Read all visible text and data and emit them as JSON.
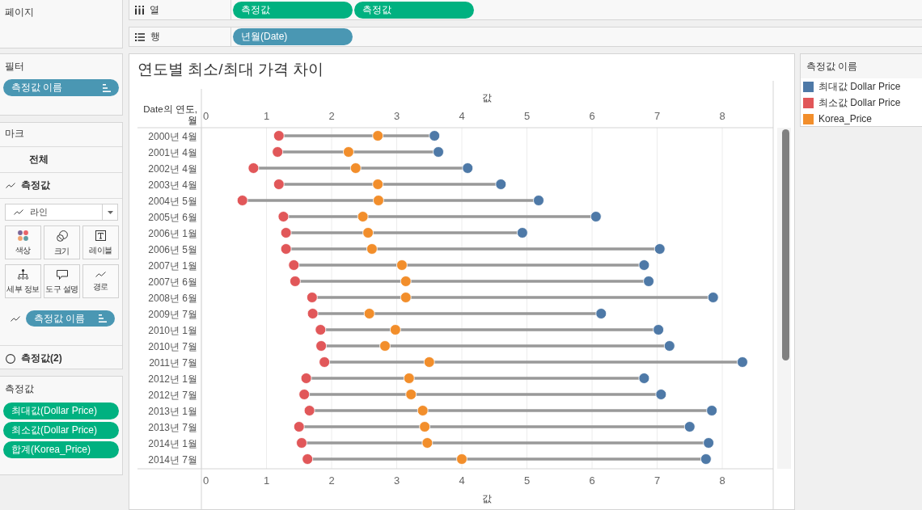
{
  "pages_card": {
    "title": "페이지"
  },
  "filters_card": {
    "title": "필터",
    "pills": [
      {
        "text": "측정값 이름",
        "kind": "dimension",
        "sorted": true
      }
    ]
  },
  "marks_card": {
    "title": "마크",
    "sections": [
      {
        "label": "전체",
        "kind": "all"
      },
      {
        "label": "측정값",
        "kind": "line",
        "mark_type": {
          "value": "라인",
          "kind": "line"
        },
        "encodings": [
          {
            "label": "색상",
            "kind": "color"
          },
          {
            "label": "크기",
            "kind": "size"
          },
          {
            "label": "레이블",
            "kind": "label"
          },
          {
            "label": "세부 정보",
            "kind": "detail"
          },
          {
            "label": "도구 설명",
            "kind": "tooltip"
          },
          {
            "label": "경로",
            "kind": "path"
          }
        ],
        "encoded_fields": [
          {
            "kind": "path",
            "pill": {
              "text": "측정값 이름",
              "kind": "dimension",
              "sorted": true
            }
          }
        ]
      },
      {
        "label": "측정값(2)",
        "kind": "circle"
      }
    ]
  },
  "measures_card": {
    "title": "측정값",
    "pills": [
      {
        "text": "최대값(Dollar Price)",
        "kind": "measure"
      },
      {
        "text": "최소값(Dollar Price)",
        "kind": "measure"
      },
      {
        "text": "합계(Korea_Price)",
        "kind": "measure"
      }
    ]
  },
  "shelves": [
    {
      "label": "열",
      "kind": "columns",
      "pills": [
        {
          "text": "측정값",
          "kind": "measure"
        },
        {
          "text": "측정값",
          "kind": "measure"
        }
      ]
    },
    {
      "label": "행",
      "kind": "rows",
      "pills": [
        {
          "text": "년월(Date)",
          "kind": "dimension"
        }
      ]
    }
  ],
  "view": {
    "chart_data": [
      {
        "type": "scatter",
        "orientation": "horizontal",
        "title": "연도별 최소/최대 가격 차이",
        "xlabel": "값",
        "x2label": "값",
        "ylabel": "Date의 연도, 월",
        "legend_title": "측정값 이름",
        "grid": true,
        "categories": [
          "2000년 4월",
          "2001년 4월",
          "2002년 4월",
          "2003년 4월",
          "2004년 5월",
          "2005년 6월",
          "2006년 1월",
          "2006년 5월",
          "2007년 1월",
          "2007년 6월",
          "2008년 6월",
          "2009년 7월",
          "2010년 1월",
          "2010년 7월",
          "2011년 7월",
          "2012년 1월",
          "2012년 7월",
          "2013년 1월",
          "2013년 7월",
          "2014년 1월",
          "2014년 7월"
        ],
        "xticks": [
          0,
          1,
          2,
          3,
          4,
          5,
          6,
          7,
          8
        ],
        "x2ticks": [
          0,
          1,
          2,
          3,
          4,
          5,
          6,
          7,
          8
        ],
        "xlim": [
          0,
          8.77
        ],
        "x2lim": [
          0,
          8.77
        ],
        "series": [
          {
            "name": "최대값 Dollar Price",
            "color": "#4e79a7",
            "values": [
              3.58,
              3.64,
              4.09,
              4.6,
              5.18,
              6.06,
              4.93,
              7.04,
              6.8,
              6.87,
              7.86,
              6.14,
              7.02,
              7.19,
              8.31,
              6.8,
              7.06,
              7.84,
              7.5,
              7.79,
              7.75
            ]
          },
          {
            "name": "최소값 Dollar Price",
            "color": "#e15759",
            "values": [
              1.19,
              1.17,
              0.8,
              1.19,
              0.63,
              1.26,
              1.3,
              1.3,
              1.42,
              1.44,
              1.7,
              1.71,
              1.83,
              1.84,
              1.89,
              1.61,
              1.58,
              1.66,
              1.5,
              1.54,
              1.63
            ]
          },
          {
            "name": "Korea_Price",
            "color": "#f28e2b",
            "values": [
              2.71,
              2.26,
              2.37,
              2.71,
              2.72,
              2.48,
              2.56,
              2.62,
              3.08,
              3.14,
              3.14,
              2.58,
              2.98,
              2.82,
              3.5,
              3.19,
              3.22,
              3.4,
              3.43,
              3.47,
              4.0
            ]
          }
        ]
      }
    ]
  }
}
